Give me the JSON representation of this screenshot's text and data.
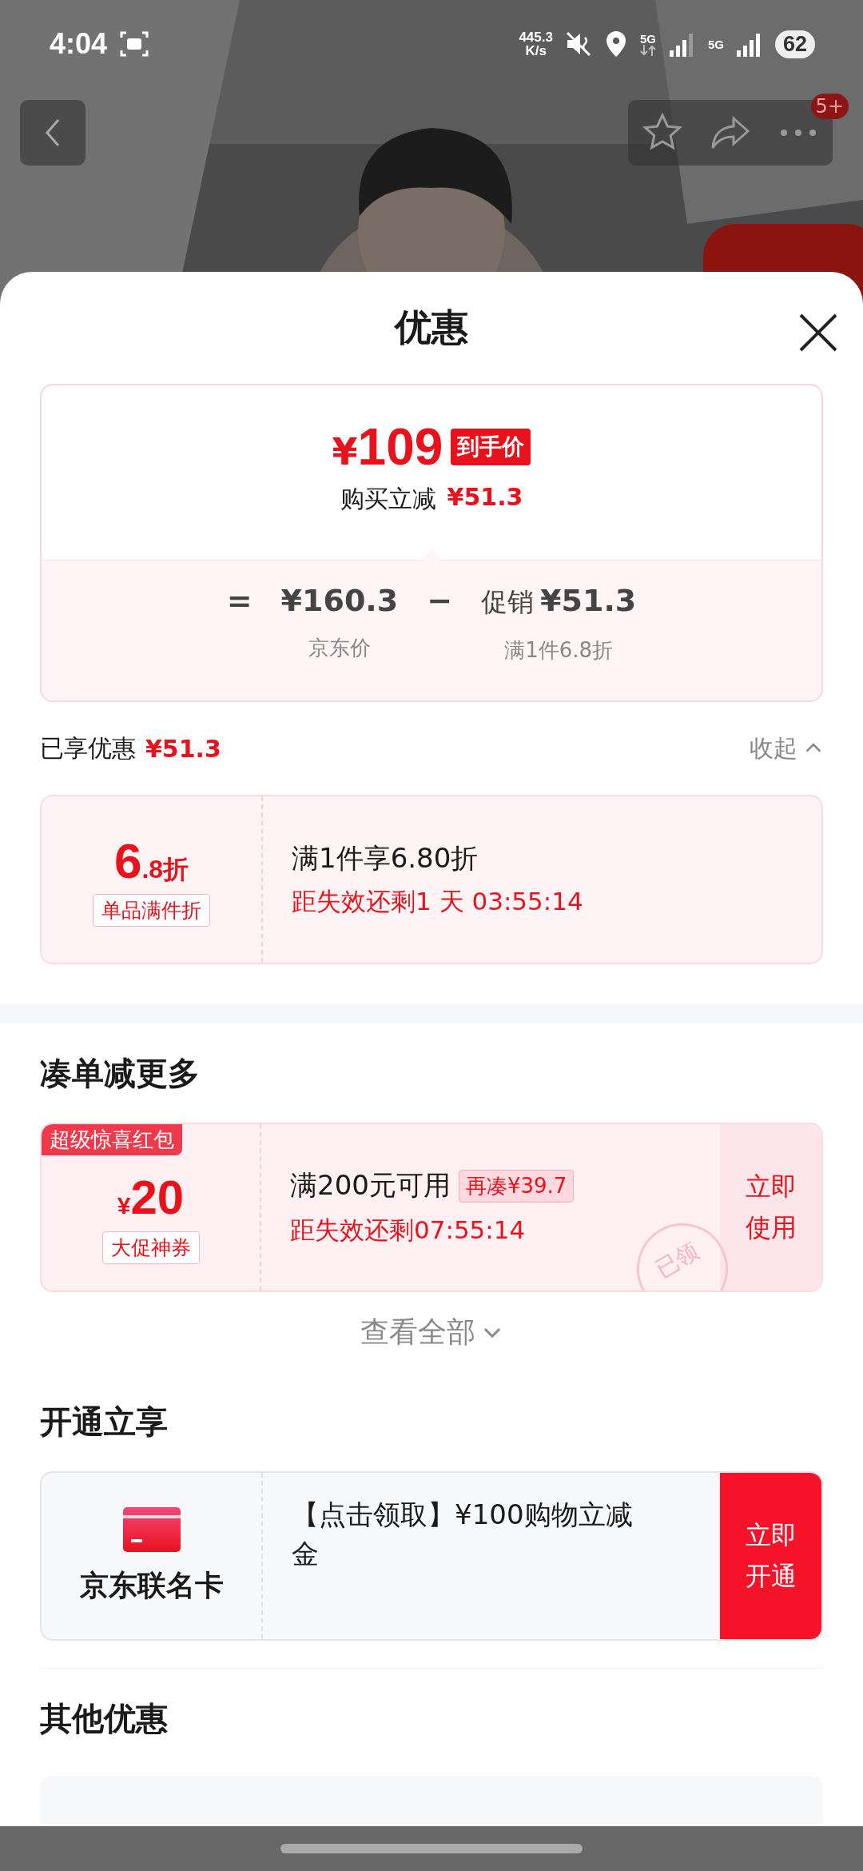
{
  "status_bar": {
    "time": "4:04",
    "speed_value": "445.3",
    "speed_unit": "K/s",
    "network_1": "5G",
    "network_2": "5G",
    "battery": "62"
  },
  "nav": {
    "badge": "5+"
  },
  "sheet": {
    "title": "优惠"
  },
  "price_card": {
    "final_price": "109",
    "currency": "¥",
    "final_tag": "到手价",
    "saving_label": "购买立减",
    "saving_value": "¥51.3",
    "formula": [
      {
        "kind": "operator",
        "text": "="
      },
      {
        "kind": "amount",
        "text": "¥160.3",
        "caption": "京东价"
      },
      {
        "kind": "operator",
        "text": "−"
      },
      {
        "kind": "amount",
        "prefix": "促销",
        "text": "¥51.3",
        "caption": "满1件6.8折"
      }
    ]
  },
  "enjoyed": {
    "label": "已享优惠",
    "value": "¥51.3",
    "toggle": "收起",
    "expanded": true
  },
  "discounts": [
    {
      "value_big": "6",
      "value_small": ".8折",
      "tag": "单品满件折",
      "title": "满1件享6.80折",
      "countdown": "距失效还剩1 天 03:55:14"
    }
  ],
  "bundle": {
    "title": "凑单减更多",
    "coupons": [
      {
        "ribbon": "超级惊喜红包",
        "currency": "¥",
        "amount": "20",
        "tag": "大促神券",
        "title": "满200元可用",
        "hint": "再凑¥39.7",
        "countdown": "距失效还剩07:55:14",
        "stamp": "已领",
        "action": "立即使用"
      }
    ],
    "view_all": "查看全部"
  },
  "membership": {
    "title": "开通立享",
    "offers": [
      {
        "name": "京东联名卡",
        "text": "【点击领取】¥100购物立减金",
        "action": "立即开通"
      }
    ]
  },
  "other": {
    "title": "其他优惠"
  }
}
